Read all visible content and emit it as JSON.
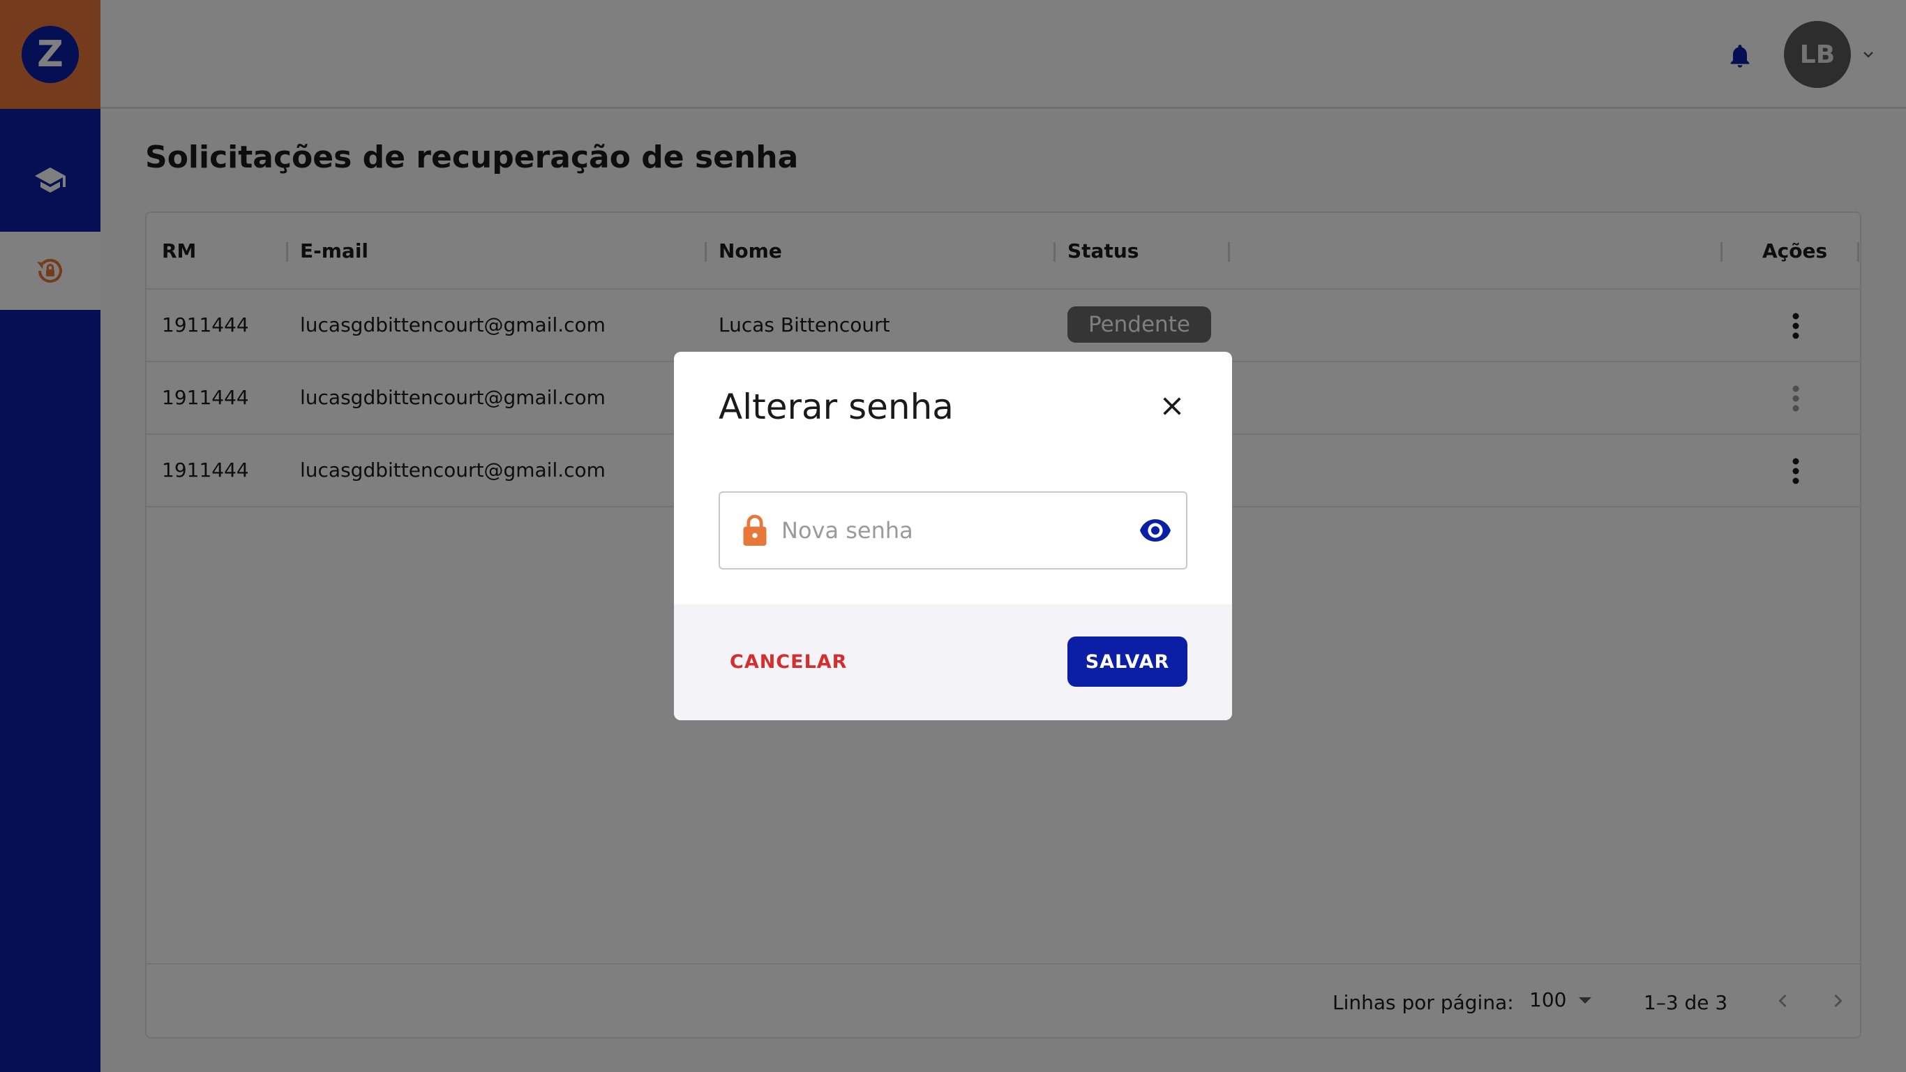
{
  "colors": {
    "primary": "#0b1fa6",
    "accent": "#e8783a",
    "danger": "#d32f2f",
    "status_pending": "#6b6b6b"
  },
  "sidebar": {
    "logo_letter": "Z",
    "items": [
      {
        "icon": "graduation-cap-icon",
        "active": false
      },
      {
        "icon": "lock-reset-icon",
        "active": true
      }
    ]
  },
  "header": {
    "notification_icon": "bell-icon",
    "avatar_initials": "LB"
  },
  "page": {
    "title": "Solicitações de recuperação de senha"
  },
  "table": {
    "columns": [
      "RM",
      "E-mail",
      "Nome",
      "Status",
      "Ações"
    ],
    "rows": [
      {
        "rm": "1911444",
        "email": "lucasgdbittencourt@gmail.com",
        "nome": "Lucas Bittencourt",
        "status": "Pendente"
      },
      {
        "rm": "1911444",
        "email": "lucasgdbittencourt@gmail.com",
        "nome": "",
        "status": ""
      },
      {
        "rm": "1911444",
        "email": "lucasgdbittencourt@gmail.com",
        "nome": "",
        "status": ""
      }
    ],
    "footer": {
      "rows_per_page_label": "Linhas por página:",
      "rows_per_page_value": "100",
      "range": "1–3 de 3"
    }
  },
  "dialog": {
    "title": "Alterar senha",
    "password_placeholder": "Nova senha",
    "cancel_label": "CANCELAR",
    "save_label": "SALVAR"
  }
}
